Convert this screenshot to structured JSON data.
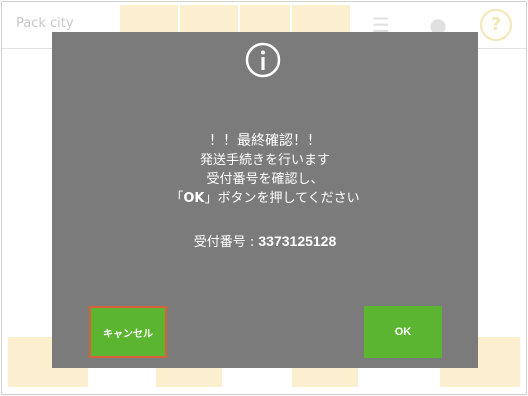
{
  "app": {
    "title": "Pack  city"
  },
  "modal": {
    "icon": "info-icon",
    "message_lines": [
      "！！最終確認！！",
      "発送手続きを行います",
      "受付番号を確認し、"
    ],
    "ok_prompt": {
      "open_bracket": "「",
      "ok_word": "OK",
      "rest": "」ボタンを押してください"
    },
    "receipt_label": "受付番号 : ",
    "receipt_number": "3373125128",
    "cancel_label": "キャンセル",
    "ok_label": "OK"
  },
  "colors": {
    "modal_bg": "#7b7b7b",
    "button_green": "#5cb531",
    "cancel_focus_border": "#d9603a",
    "bg_accent_yellow": "#fbefcf"
  }
}
